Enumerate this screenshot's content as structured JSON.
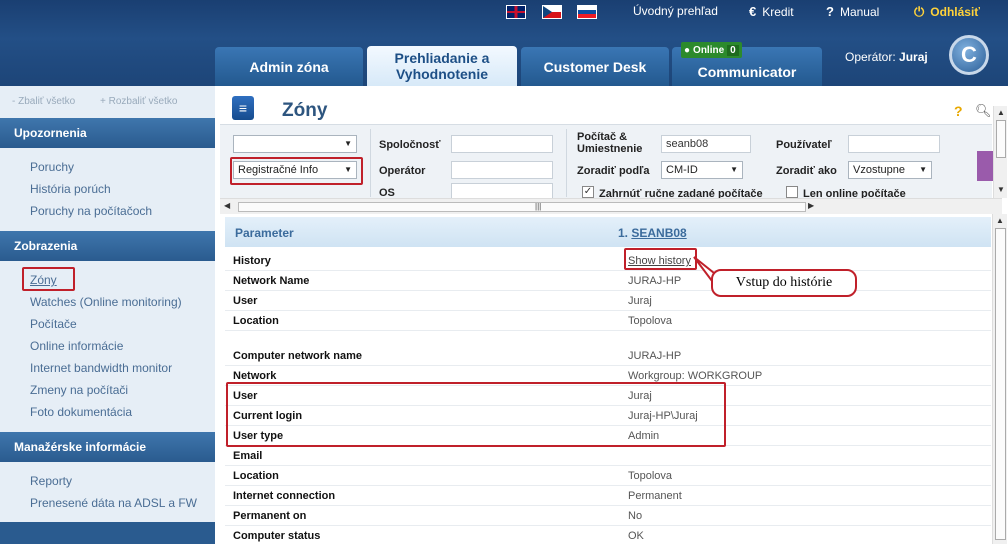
{
  "header": {
    "links": {
      "home": "Úvodný prehľad",
      "credit": "Kredit",
      "manual": "Manual",
      "logout": "Odhlásiť"
    },
    "tabs": [
      "Admin zóna",
      "Prehliadanie a Vyhodnotenie",
      "Customer Desk",
      "Communicator"
    ],
    "active_tab": 1,
    "online_badge": {
      "label": "Online",
      "count": "0"
    },
    "operator_label": "Operátor:",
    "operator_name": "Juraj",
    "logo_letter": "C",
    "flags": [
      "flag-uk-icon",
      "flag-cz-icon",
      "flag-sk-icon"
    ]
  },
  "sidebar": {
    "collapse_all": "Zbaliť všetko",
    "expand_all": "Rozbaliť všetko",
    "sections": [
      {
        "title": "Upozornenia",
        "items": [
          "Poruchy",
          "História porúch",
          "Poruchy na počítačoch"
        ]
      },
      {
        "title": "Zobrazenia",
        "items": [
          "Zóny",
          "Watches (Online monitoring)",
          "Počítače",
          "Online informácie",
          "Internet bandwidth monitor",
          "Zmeny na počítači",
          "Foto dokumentácia"
        ]
      },
      {
        "title": "Manažérske informácie",
        "items": [
          "Reporty",
          "Prenesené dáta na ADSL a FW"
        ]
      }
    ]
  },
  "page": {
    "title": "Zóny",
    "help_icon": "?",
    "filters": {
      "select1_value": "",
      "select2_value": "Registračné Info",
      "company_label": "Spoločnosť",
      "company_value": "",
      "operator_label": "Operátor",
      "operator_value": "",
      "os_label": "OS",
      "os_value": "",
      "computer_label": "Počítač & Umiestnenie",
      "computer_value": "seanb08",
      "sort_by_label": "Zoradiť podľa",
      "sort_by_value": "CM-ID",
      "user_label": "Používateľ",
      "user_value": "",
      "sort_as_label": "Zoradiť ako",
      "sort_as_value": "Vzostupne",
      "include_manual_label": "Zahrnúť ručne zadané počítače",
      "include_manual_checked": true,
      "online_only_label": "Len online počítače",
      "online_only_checked": false
    },
    "table": {
      "col_param": "Parameter",
      "col_value_prefix": "1.",
      "col_value_name": "SEANB08",
      "rows": [
        {
          "k": "History",
          "v": "Show history"
        },
        {
          "k": "Network Name",
          "v": "JURAJ-HP"
        },
        {
          "k": "User",
          "v": "Juraj"
        },
        {
          "k": "Location",
          "v": "Topolova"
        },
        {
          "k": "",
          "v": ""
        },
        {
          "k": "Computer network name",
          "v": "JURAJ-HP"
        },
        {
          "k": "Network",
          "v": "Workgroup: WORKGROUP"
        },
        {
          "k": "User",
          "v": "Juraj"
        },
        {
          "k": "Current login",
          "v": "Juraj-HP\\Juraj"
        },
        {
          "k": "User type",
          "v": "Admin"
        },
        {
          "k": "Email",
          "v": ""
        },
        {
          "k": "Location",
          "v": "Topolova"
        },
        {
          "k": "Internet connection",
          "v": "Permanent"
        },
        {
          "k": "Permanent on",
          "v": "No"
        },
        {
          "k": "Computer status",
          "v": "OK"
        }
      ]
    },
    "callout": "Vstup do histórie"
  }
}
